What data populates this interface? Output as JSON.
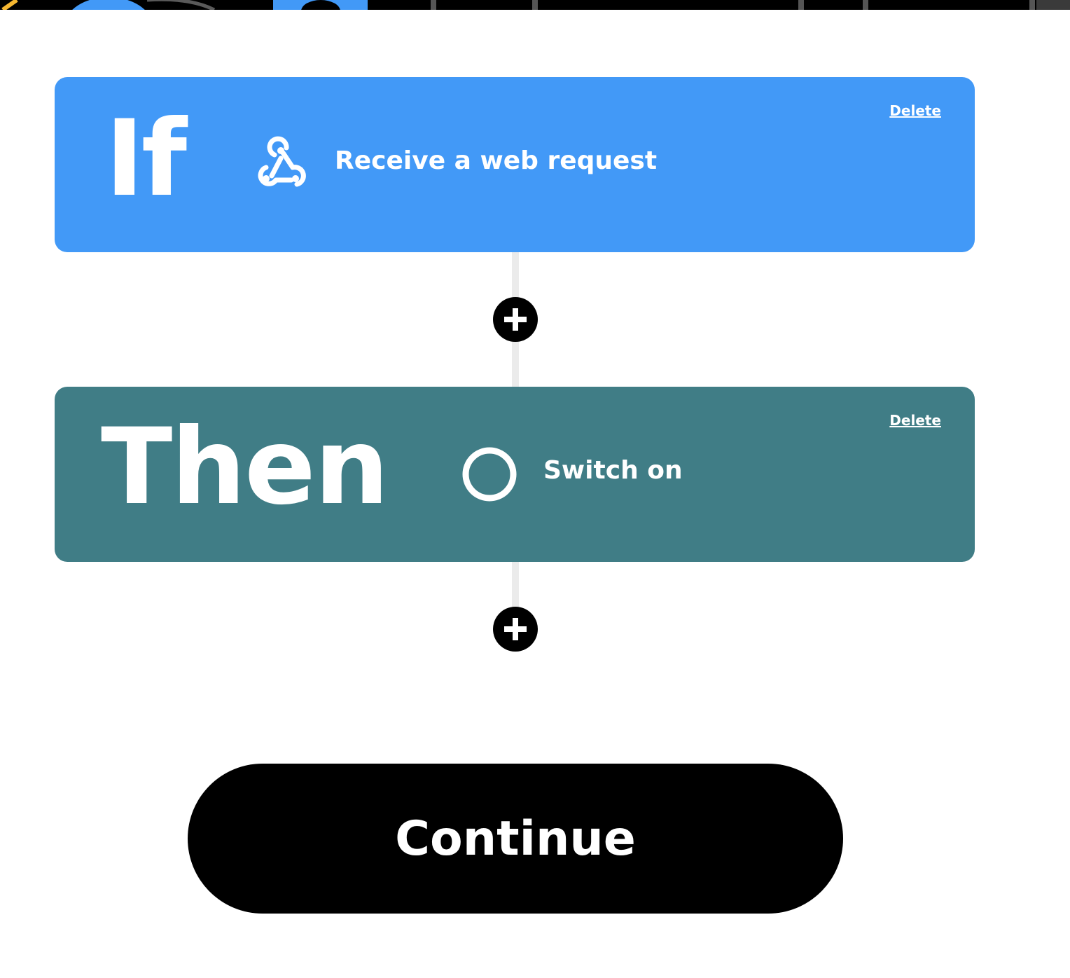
{
  "colors": {
    "if_card": "#4299f7",
    "then_card": "#407d86",
    "connector": "#ebebeb",
    "button": "#000000",
    "text_on_card": "#ffffff"
  },
  "trigger": {
    "keyword": "If",
    "icon": "webhook-icon",
    "label": "Receive a web request",
    "delete_label": "Delete"
  },
  "action": {
    "keyword": "Then",
    "icon": "ring-icon",
    "label": "Switch on",
    "delete_label": "Delete"
  },
  "add_buttons": [
    {
      "icon": "plus-icon"
    },
    {
      "icon": "plus-icon"
    }
  ],
  "continue": {
    "label": "Continue"
  }
}
